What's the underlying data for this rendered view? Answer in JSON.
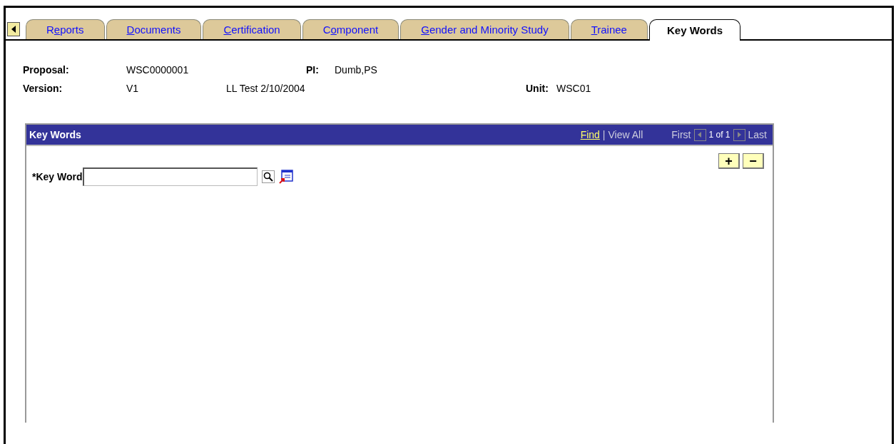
{
  "tabs": [
    {
      "label_before": "R",
      "access_key": "e",
      "label_after": "ports",
      "selected": false
    },
    {
      "access_key": "D",
      "label_after": "ocuments",
      "selected": false
    },
    {
      "access_key": "C",
      "label_after": "ertification",
      "selected": false
    },
    {
      "label_before": "C",
      "access_key": "o",
      "label_after": "mponent",
      "selected": false
    },
    {
      "access_key": "G",
      "label_after": "ender and Minority Study",
      "selected": false
    },
    {
      "access_key": "T",
      "label_after": "rainee",
      "selected": false
    },
    {
      "label_before": "Key Words",
      "selected": true
    }
  ],
  "header": {
    "proposal_label": "Proposal:",
    "proposal": "WSC0000001",
    "pi_label": "PI:",
    "pi": "Dumb,PS",
    "version_label": "Version:",
    "version": "V1",
    "description": "LL Test 2/10/2004",
    "unit_label": "Unit:",
    "unit": "WSC01"
  },
  "grid": {
    "title": "Key Words",
    "find": "Find",
    "separator": "|",
    "view_all": "View All",
    "first": "First",
    "count": "1 of 1",
    "last": "Last",
    "add": "+",
    "remove": "−",
    "field_label": "*Key Word"
  }
}
